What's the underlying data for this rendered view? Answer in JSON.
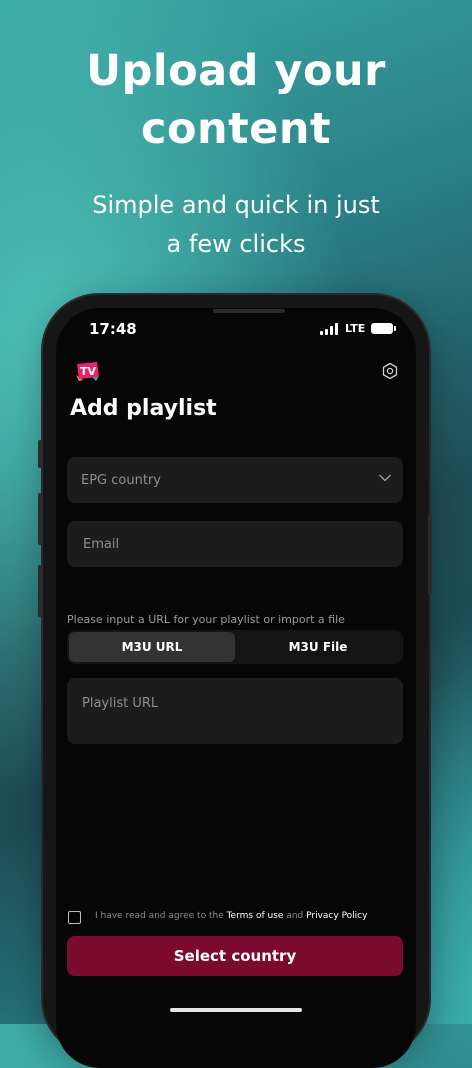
{
  "promo": {
    "headline_line1": "Upload your",
    "headline_line2": "content",
    "subline_line1": "Simple and quick in just",
    "subline_line2": "a few clicks"
  },
  "status_bar": {
    "time": "17:48",
    "network": "LTE",
    "signal_icon": "signal-bars-icon",
    "battery_icon": "battery-full-icon"
  },
  "app": {
    "logo_text": "TV",
    "settings_icon": "settings-hexagon-icon",
    "title": "Add playlist"
  },
  "form": {
    "epg_country": {
      "placeholder": "EPG country",
      "value": "",
      "icon": "chevron-down-icon"
    },
    "email": {
      "placeholder": "Email",
      "value": ""
    },
    "hint": "Please input a URL for your playlist or import a file",
    "source_tabs": [
      {
        "label": "M3U URL",
        "selected": true
      },
      {
        "label": "M3U File",
        "selected": false
      }
    ],
    "playlist_url": {
      "placeholder": "Playlist URL",
      "value": ""
    }
  },
  "agreement": {
    "checked": false,
    "prefix": "I have read and agree to the",
    "terms_link": "Terms of use",
    "and": "and",
    "privacy_link": "Privacy Policy"
  },
  "cta_label": "Select country",
  "colors": {
    "cta_background": "#7a0b2e",
    "screen_background": "#060606",
    "field_background": "#1c1c1c",
    "logo_pink": "#e8246e",
    "logo_orange": "#f59a23",
    "logo_green": "#23b99a"
  }
}
